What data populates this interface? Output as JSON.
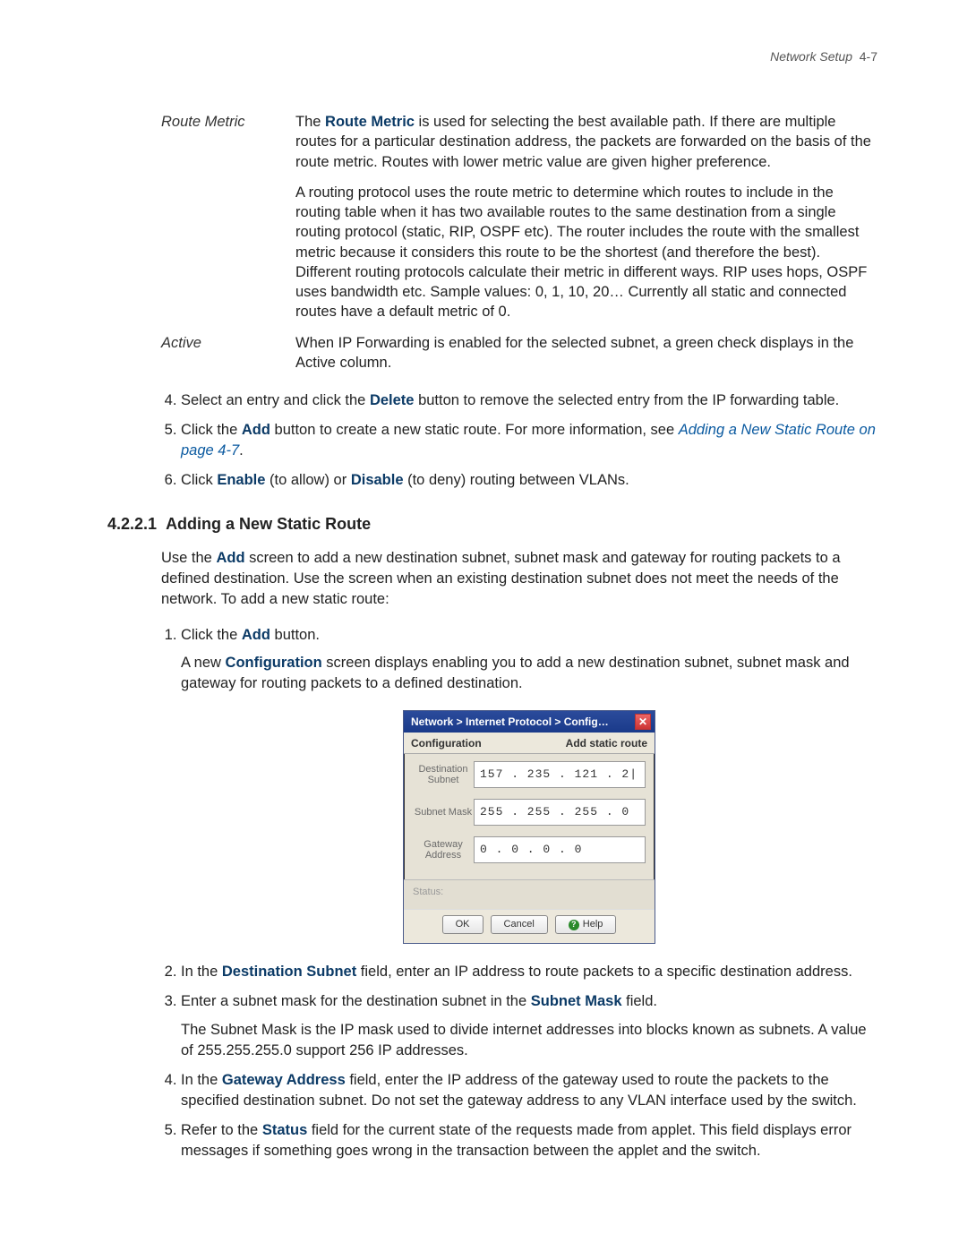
{
  "header": {
    "section": "Network Setup",
    "page_label": "4-7"
  },
  "definitions": {
    "route_metric": {
      "term": "Route Metric",
      "p1_pre": "The ",
      "p1_bold": "Route Metric",
      "p1_post": " is used for selecting the best available path. If there are multiple routes for a particular destination address, the packets are forwarded on the basis of the route metric. Routes with lower metric value are given higher preference.",
      "p2": "A routing protocol uses the route metric to determine which routes to include in the routing table when it has two available routes to the same destination from a single routing protocol (static, RIP, OSPF etc). The router includes the route with the smallest metric because it considers this route to be the shortest (and therefore the best). Different routing protocols calculate their metric in different ways. RIP uses hops, OSPF uses bandwidth etc. Sample values: 0, 1, 10, 20… Currently all static and connected routes have a default metric of 0."
    },
    "active": {
      "term": "Active",
      "p1": "When IP Forwarding is enabled for the selected subnet, a green check displays in the Active column."
    }
  },
  "steps_a": {
    "s4_pre": "Select an entry and click the ",
    "s4_bold": "Delete",
    "s4_post": " button to remove the selected entry from the IP forwarding table.",
    "s5_pre": "Click the ",
    "s5_bold": "Add",
    "s5_mid": " button to create a new static route. For more information, see ",
    "s5_link": "Adding a New Static Route on page 4-7",
    "s5_post": ".",
    "s6_pre": "Click ",
    "s6_b1": "Enable",
    "s6_mid": " (to allow) or ",
    "s6_b2": "Disable",
    "s6_post": " (to deny) routing between VLANs."
  },
  "subheading": {
    "number": "4.2.2.1",
    "title": "Adding a New Static Route"
  },
  "intro": {
    "pre": "Use the ",
    "bold": "Add",
    "post": " screen to add a new destination subnet, subnet mask and gateway for routing packets to a defined destination. Use the screen when an existing destination subnet does not meet the needs of the network. To add a new static route:"
  },
  "steps_b": {
    "s1_pre": "Click the ",
    "s1_bold": "Add",
    "s1_post": " button.",
    "s1_sub_pre": "A new ",
    "s1_sub_bold": "Configuration",
    "s1_sub_post": " screen displays enabling you to add a new destination subnet, subnet mask and gateway for routing packets to a defined destination.",
    "s2_pre": "In the ",
    "s2_bold": "Destination Subnet",
    "s2_post": " field, enter an IP address to route packets to a specific destination address.",
    "s3_pre": "Enter a subnet mask for the destination subnet in the ",
    "s3_bold": "Subnet Mask",
    "s3_post": " field.",
    "s3_sub": "The Subnet Mask is the IP mask used to divide internet addresses into blocks known as subnets. A value of 255.255.255.0 support 256 IP addresses.",
    "s4_pre": "In the ",
    "s4_bold": "Gateway Address",
    "s4_post": " field, enter the IP address of the gateway used to route the packets to the specified destination subnet. Do not set the gateway address to any VLAN interface used by the switch.",
    "s5_pre": "Refer to the ",
    "s5_bold": "Status",
    "s5_post": " field for the current state of the requests made from applet. This field displays error messages if something goes wrong in the transaction between the applet and the switch."
  },
  "dialog": {
    "title": "Network > Internet Protocol > Config…",
    "close_glyph": "✕",
    "section_left": "Configuration",
    "section_right": "Add static route",
    "dest_label": "Destination Subnet",
    "dest_value": "157 . 235 . 121 .  2|",
    "mask_label": "Subnet Mask",
    "mask_value": "255 . 255 . 255 .  0",
    "gw_label": "Gateway Address",
    "gw_value": "  0  .  0  .  0  .  0",
    "status_label": "Status:",
    "ok": "OK",
    "cancel": "Cancel",
    "help": "Help",
    "help_icon": "?"
  }
}
